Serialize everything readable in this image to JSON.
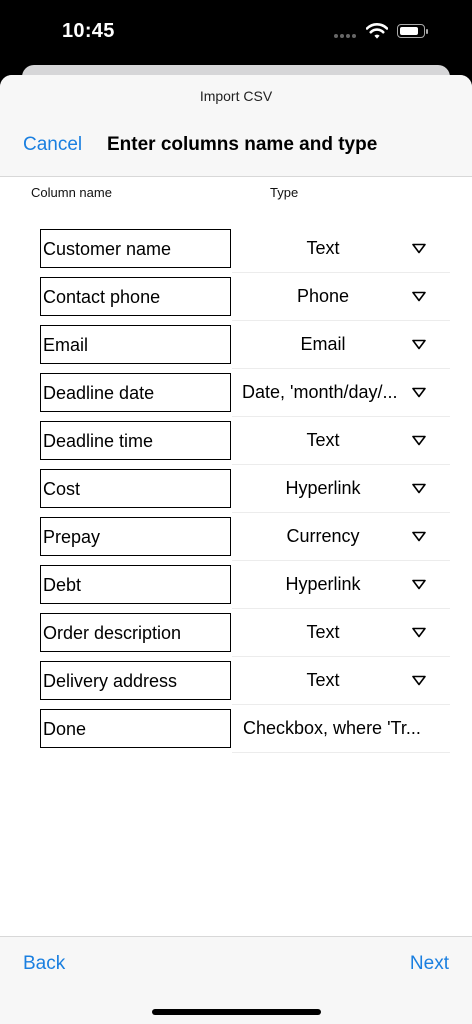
{
  "status_bar": {
    "time": "10:45"
  },
  "header": {
    "subtitle": "Import CSV",
    "cancel_label": "Cancel",
    "title": "Enter columns name and type"
  },
  "columns_header": {
    "name": "Column name",
    "type": "Type"
  },
  "rows": [
    {
      "name": "Customer name",
      "type": "Text"
    },
    {
      "name": "Contact phone",
      "type": "Phone"
    },
    {
      "name": "Email",
      "type": "Email"
    },
    {
      "name": "Deadline date",
      "type": "Date, 'month/day/..."
    },
    {
      "name": "Deadline time",
      "type": "Text"
    },
    {
      "name": "Cost",
      "type": "Hyperlink"
    },
    {
      "name": "Prepay",
      "type": "Currency"
    },
    {
      "name": "Debt",
      "type": "Hyperlink"
    },
    {
      "name": "Order description",
      "type": "Text"
    },
    {
      "name": "Delivery address",
      "type": "Text"
    },
    {
      "name": "Done",
      "type": "Checkbox, where 'Tr..."
    }
  ],
  "footer": {
    "back_label": "Back",
    "next_label": "Next"
  },
  "colors": {
    "accent": "#1a7fe0",
    "bar_background": "#f7f7f7",
    "divider": "#d8d8d8"
  },
  "icons": {
    "dropdown": "triangle-down-icon",
    "wifi": "wifi-icon",
    "battery": "battery-icon"
  }
}
